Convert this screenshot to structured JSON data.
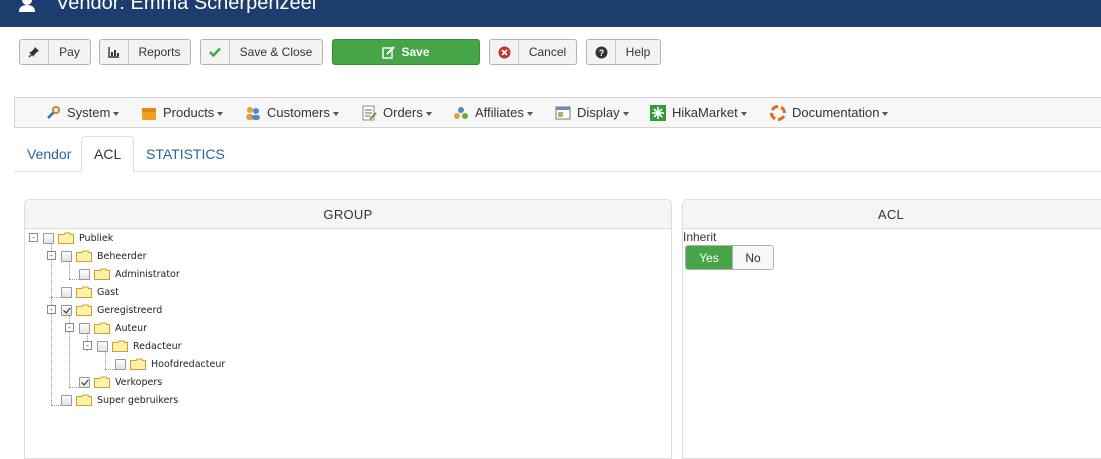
{
  "header": {
    "title": "Vendor: Emma Scherpenzeel",
    "icon": "user-icon"
  },
  "toolbar": {
    "pay_label": "Pay",
    "reports_label": "Reports",
    "save_close_label": "Save & Close",
    "save_label": "Save",
    "cancel_label": "Cancel",
    "help_label": "Help"
  },
  "menu": {
    "items": [
      {
        "label": "System",
        "icon": "wrench-icon"
      },
      {
        "label": "Products",
        "icon": "box-icon"
      },
      {
        "label": "Customers",
        "icon": "users-icon"
      },
      {
        "label": "Orders",
        "icon": "orders-icon"
      },
      {
        "label": "Affiliates",
        "icon": "affiliates-icon"
      },
      {
        "label": "Display",
        "icon": "display-icon"
      },
      {
        "label": "HikaMarket",
        "icon": "hikamarket-icon"
      },
      {
        "label": "Documentation",
        "icon": "lifebuoy-icon"
      }
    ]
  },
  "tabs": [
    "Vendor",
    "ACL",
    "STATISTICS"
  ],
  "active_tab": "ACL",
  "group_panel": {
    "heading": "GROUP",
    "tree": [
      {
        "label": "Publiek",
        "checked": false,
        "toggle": "-"
      },
      {
        "label": "Beheerder",
        "checked": false,
        "toggle": "-"
      },
      {
        "label": "Administrator",
        "checked": false,
        "toggle": ""
      },
      {
        "label": "Gast",
        "checked": false,
        "toggle": ""
      },
      {
        "label": "Geregistreerd",
        "checked": true,
        "toggle": "-"
      },
      {
        "label": "Auteur",
        "checked": false,
        "toggle": "-"
      },
      {
        "label": "Redacteur",
        "checked": false,
        "toggle": "-"
      },
      {
        "label": "Hoofdredacteur",
        "checked": false,
        "toggle": ""
      },
      {
        "label": "Verkopers",
        "checked": true,
        "toggle": ""
      },
      {
        "label": "Super gebruikers",
        "checked": false,
        "toggle": ""
      }
    ]
  },
  "acl_panel": {
    "heading": "ACL",
    "inherit_label": "Inherit",
    "yes_label": "Yes",
    "no_label": "No",
    "selected": "Yes"
  },
  "colors": {
    "header_bg": "#1c3d6e",
    "save_green": "#46a546",
    "link_blue": "#2a6496"
  }
}
